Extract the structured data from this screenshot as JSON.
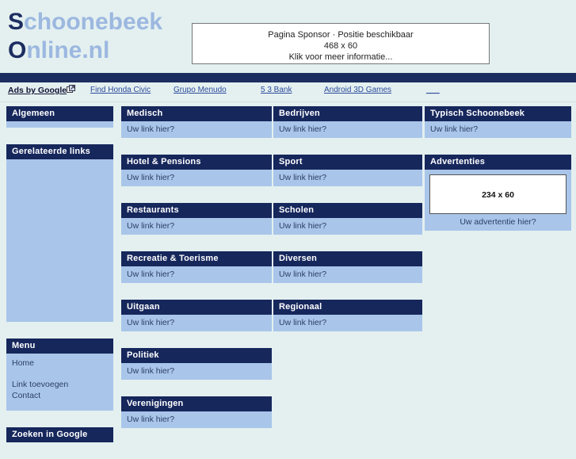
{
  "site": {
    "logo_line1_cap": "S",
    "logo_line1_rest": "choonebeek",
    "logo_line2_cap": "O",
    "logo_line2_rest": "nline.nl"
  },
  "sponsor": {
    "line1": "Pagina Sponsor · Positie beschikbaar",
    "line2": "468 x 60",
    "line3": "Klik voor meer informatie..."
  },
  "ads_bar": {
    "label": "Ads by Google",
    "links": [
      "Find Honda Civic",
      "Grupo Menudo",
      "5 3 Bank",
      "Android 3D Games",
      "___"
    ]
  },
  "sidebar": {
    "algemeen": {
      "title": "Algemeen"
    },
    "gerelateerde": {
      "title": "Gerelateerde links"
    },
    "menu": {
      "title": "Menu",
      "items": [
        "Home",
        "Link toevoegen",
        "Contact"
      ]
    },
    "zoeken": {
      "title": "Zoeken in Google"
    }
  },
  "columns": {
    "mid1": [
      {
        "title": "Medisch",
        "link": "Uw link hier?"
      },
      {
        "title": "Hotel & Pensions",
        "link": "Uw link hier?"
      },
      {
        "title": "Restaurants",
        "link": "Uw link hier?"
      },
      {
        "title": "Recreatie & Toerisme",
        "link": "Uw link hier?"
      },
      {
        "title": "Uitgaan",
        "link": "Uw link hier?"
      },
      {
        "title": "Politiek",
        "link": "Uw link hier?"
      },
      {
        "title": "Verenigingen",
        "link": "Uw link hier?"
      }
    ],
    "mid2": [
      {
        "title": "Bedrijven",
        "link": "Uw link hier?"
      },
      {
        "title": "Sport",
        "link": "Uw link hier?"
      },
      {
        "title": "Scholen",
        "link": "Uw link hier?"
      },
      {
        "title": "Diversen",
        "link": "Uw link hier?"
      },
      {
        "title": "Regionaal",
        "link": "Uw link hier?"
      }
    ],
    "right": [
      {
        "title": "Typisch Schoonebeek",
        "link": "Uw link hier?"
      }
    ],
    "advertenties": {
      "title": "Advertenties",
      "placeholder_size": "234 x 60",
      "caption": "Uw advertentie hier?"
    }
  },
  "colors": {
    "page_bg": "#e4f0f0",
    "navy": "#16275c",
    "panel_body": "#a9c5e9",
    "logo_light": "#9cb8e0",
    "link_blue": "#2b4a9b"
  }
}
